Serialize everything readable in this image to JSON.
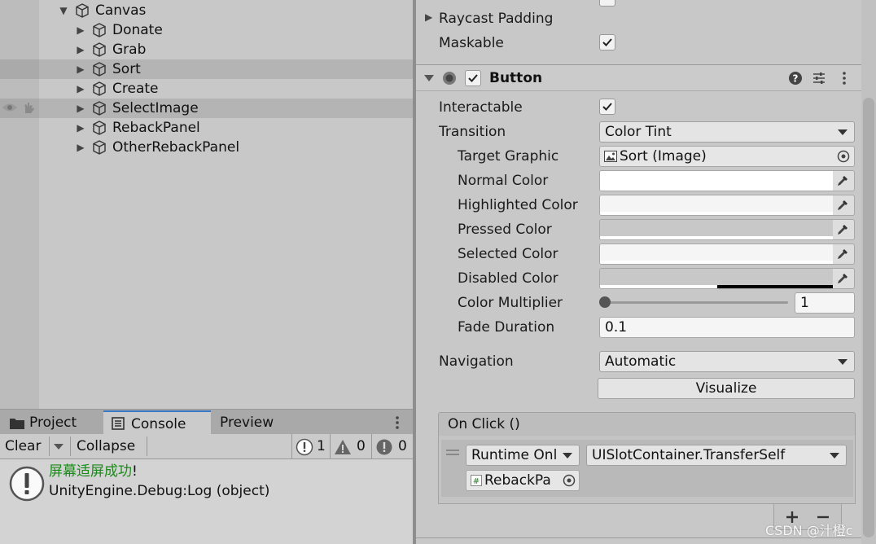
{
  "hierarchy": {
    "items": [
      {
        "label": "Canvas"
      },
      {
        "label": "Donate"
      },
      {
        "label": "Grab"
      },
      {
        "label": "Sort"
      },
      {
        "label": "Create"
      },
      {
        "label": "SelectImage"
      },
      {
        "label": "RebackPanel"
      },
      {
        "label": "OtherRebackPanel"
      }
    ]
  },
  "console": {
    "tabs": [
      {
        "label": "Project"
      },
      {
        "label": "Console"
      },
      {
        "label": "Preview"
      }
    ],
    "toolbar": {
      "clear_label": "Clear",
      "collapse_label": "Collapse",
      "info_count": "1",
      "warning_count": "0",
      "error_count": "0"
    },
    "log": {
      "message": "屏幕适屏成功",
      "message_suffix": "!",
      "source": "UnityEngine.Debug:Log (object)",
      "message_color": "#1a8a1a"
    }
  },
  "inspector": {
    "image": {
      "raycast_padding_label": "Raycast Padding",
      "maskable_label": "Maskable",
      "maskable": true
    },
    "button": {
      "title": "Button",
      "enabled": true,
      "interactable_label": "Interactable",
      "interactable": true,
      "transition_label": "Transition",
      "transition_value": "Color Tint",
      "target_graphic_label": "Target Graphic",
      "target_graphic_value": "Sort (Image)",
      "normal_color_label": "Normal Color",
      "normal_color": "#ffffff",
      "highlighted_color_label": "Highlighted Color",
      "highlighted_color": "#f5f5f5",
      "pressed_color_label": "Pressed Color",
      "pressed_color": "#c8c8c8",
      "selected_color_label": "Selected Color",
      "selected_color": "#f5f5f5",
      "disabled_color_label": "Disabled Color",
      "disabled_color": "#c8c8c8",
      "color_multiplier_label": "Color Multiplier",
      "color_multiplier_value": "1",
      "fade_duration_label": "Fade Duration",
      "fade_duration_value": "0.1",
      "navigation_label": "Navigation",
      "navigation_value": "Automatic",
      "visualize_label": "Visualize",
      "on_click": {
        "title": "On Click ()",
        "runtime_value": "Runtime Only",
        "function_value": "UISlotContainer.TransferSelf",
        "object_value": "RebackPa"
      }
    }
  },
  "watermark": "CSDN @汁橙c"
}
